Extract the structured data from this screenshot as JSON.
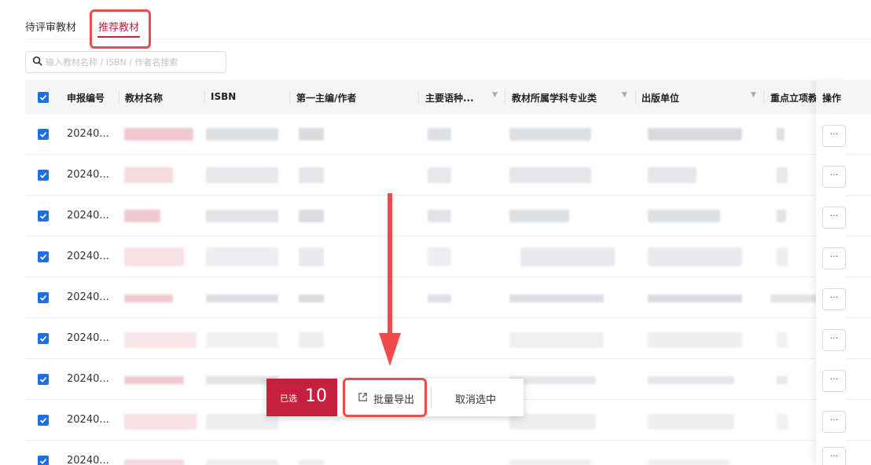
{
  "tabs": [
    {
      "label": "待评审教材",
      "active": false
    },
    {
      "label": "推荐教材",
      "active": true
    }
  ],
  "search": {
    "placeholder": "输入教材名称 / ISBN / 作者名搜索",
    "value": ""
  },
  "table": {
    "columns": [
      "申报编号",
      "教材名称",
      "ISBN",
      "第一主编/作者",
      "主要语种...",
      "教材所属学科专业类",
      "出版单位",
      "重点立项教材",
      "操作"
    ],
    "filterable_columns": [
      "主要语种...",
      "教材所属学科专业类",
      "出版单位"
    ],
    "header_checked": true,
    "rows": [
      {
        "id": "20240...",
        "checked": true
      },
      {
        "id": "20240...",
        "checked": true
      },
      {
        "id": "20240...",
        "checked": true
      },
      {
        "id": "20240...",
        "checked": true
      },
      {
        "id": "20240...",
        "checked": true
      },
      {
        "id": "20240...",
        "checked": true
      },
      {
        "id": "20240...",
        "checked": true
      },
      {
        "id": "20240...",
        "checked": true
      },
      {
        "id": "20240...",
        "checked": true
      }
    ],
    "more_label": "···"
  },
  "batch_bar": {
    "selected_label": "已选",
    "selected_count": "10",
    "export_label": "批量导出",
    "cancel_label": "取消选中"
  },
  "colors": {
    "accent": "#c5203d",
    "checkbox": "#1e6fe0",
    "annotation": "#ee4c4c"
  },
  "icons": [
    "search-icon",
    "export-icon",
    "check-icon",
    "filter-icon"
  ]
}
